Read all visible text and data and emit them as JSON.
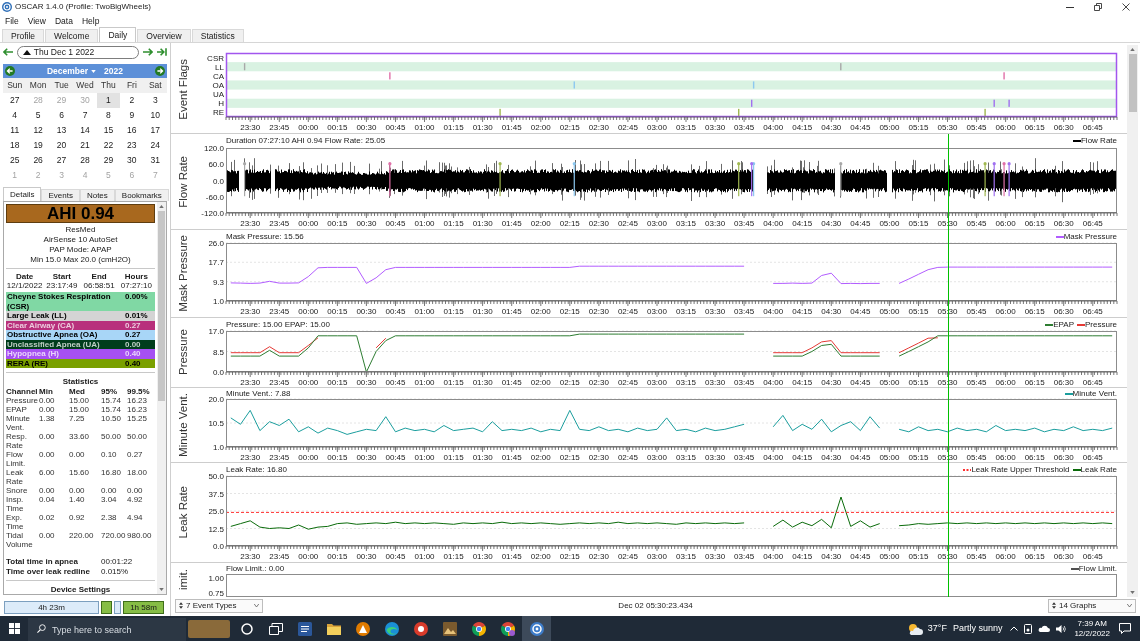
{
  "window": {
    "title": "OSCAR 1.4.0 (Profile: TwoBigWheels)"
  },
  "menu": [
    "File",
    "View",
    "Data",
    "Help"
  ],
  "tabs": [
    {
      "label": "Profile",
      "selected": false
    },
    {
      "label": "Welcome",
      "selected": false
    },
    {
      "label": "Daily",
      "selected": true
    },
    {
      "label": "Overview",
      "selected": false
    },
    {
      "label": "Statistics",
      "selected": false
    }
  ],
  "date_nav": {
    "value": "Thu Dec 1 2022"
  },
  "calendar": {
    "month": "December",
    "year": "2022",
    "weekdays": [
      "Sun",
      "Mon",
      "Tue",
      "Wed",
      "Thu",
      "Fri",
      "Sat"
    ],
    "weeks": [
      [
        {
          "day": "27",
          "muted": false,
          "selected": false
        },
        {
          "day": "28",
          "muted": true,
          "selected": false
        },
        {
          "day": "29",
          "muted": true,
          "selected": false
        },
        {
          "day": "30",
          "muted": true,
          "selected": false
        },
        {
          "day": "1",
          "muted": false,
          "selected": true
        },
        {
          "day": "2",
          "muted": false,
          "selected": false
        },
        {
          "day": "3",
          "muted": false,
          "selected": false
        }
      ],
      [
        {
          "day": "4",
          "muted": false,
          "selected": false
        },
        {
          "day": "5",
          "muted": false,
          "selected": false
        },
        {
          "day": "6",
          "muted": false,
          "selected": false
        },
        {
          "day": "7",
          "muted": false,
          "selected": false
        },
        {
          "day": "8",
          "muted": false,
          "selected": false
        },
        {
          "day": "9",
          "muted": false,
          "selected": false
        },
        {
          "day": "10",
          "muted": false,
          "selected": false
        }
      ],
      [
        {
          "day": "11",
          "muted": false,
          "selected": false
        },
        {
          "day": "12",
          "muted": false,
          "selected": false
        },
        {
          "day": "13",
          "muted": false,
          "selected": false
        },
        {
          "day": "14",
          "muted": false,
          "selected": false
        },
        {
          "day": "15",
          "muted": false,
          "selected": false
        },
        {
          "day": "16",
          "muted": false,
          "selected": false
        },
        {
          "day": "17",
          "muted": false,
          "selected": false
        }
      ],
      [
        {
          "day": "18",
          "muted": false,
          "selected": false
        },
        {
          "day": "19",
          "muted": false,
          "selected": false
        },
        {
          "day": "20",
          "muted": false,
          "selected": false
        },
        {
          "day": "21",
          "muted": false,
          "selected": false
        },
        {
          "day": "22",
          "muted": false,
          "selected": false
        },
        {
          "day": "23",
          "muted": false,
          "selected": false
        },
        {
          "day": "24",
          "muted": false,
          "selected": false
        }
      ],
      [
        {
          "day": "25",
          "muted": false,
          "selected": false
        },
        {
          "day": "26",
          "muted": false,
          "selected": false
        },
        {
          "day": "27",
          "muted": false,
          "selected": false
        },
        {
          "day": "28",
          "muted": false,
          "selected": false
        },
        {
          "day": "29",
          "muted": false,
          "selected": false
        },
        {
          "day": "30",
          "muted": false,
          "selected": false
        },
        {
          "day": "31",
          "muted": false,
          "selected": false
        }
      ],
      [
        {
          "day": "1",
          "muted": true,
          "selected": false
        },
        {
          "day": "2",
          "muted": true,
          "selected": false
        },
        {
          "day": "3",
          "muted": true,
          "selected": false
        },
        {
          "day": "4",
          "muted": true,
          "selected": false
        },
        {
          "day": "5",
          "muted": true,
          "selected": false
        },
        {
          "day": "6",
          "muted": true,
          "selected": false
        },
        {
          "day": "7",
          "muted": true,
          "selected": false
        }
      ]
    ]
  },
  "detail_tabs": [
    {
      "label": "Details",
      "selected": true
    },
    {
      "label": "Events",
      "selected": false
    },
    {
      "label": "Notes",
      "selected": false
    },
    {
      "label": "Bookmarks",
      "selected": false
    }
  ],
  "details": {
    "ahi": "AHI 0.94",
    "machine": [
      "ResMed",
      "AirSense 10 AutoSet",
      "PAP Mode: APAP",
      "Min 15.0 Max 20.0 (cmH2O)"
    ],
    "session_header": [
      "Date",
      "Start",
      "End",
      "Hours"
    ],
    "session_row": [
      "12/1/2022",
      "23:17:49",
      "06:58:51",
      "07:27:10"
    ],
    "events": [
      {
        "label": "Cheyne Stokes Respiration (CSR)",
        "value": "0.00%",
        "color": "#80d8a4"
      },
      {
        "label": "Large Leak (LL)",
        "value": "0.01%",
        "color": "#d4d4d4"
      },
      {
        "label": "Clear Airway (CA)",
        "value": "0.27",
        "color": "#b8307c"
      },
      {
        "label": "Obstructive Apnea (OA)",
        "value": "0.27",
        "color": "#a8d6f7"
      },
      {
        "label": "Unclassified Apnea (UA)",
        "value": "0.00",
        "color": "#003d1c"
      },
      {
        "label": "Hypopnea (H)",
        "value": "0.40",
        "color": "#a650f2"
      },
      {
        "label": "RERA (RE)",
        "value": "0.40",
        "color": "#7aa000"
      }
    ],
    "statistics_title": "Statistics",
    "statistics_header": [
      "Channel",
      "Min",
      "Med",
      "95%",
      "99.5%"
    ],
    "statistics_rows": [
      [
        "Pressure",
        "0.00",
        "15.00",
        "15.74",
        "16.23"
      ],
      [
        "EPAP",
        "0.00",
        "15.00",
        "15.74",
        "16.23"
      ],
      [
        "Minute Vent.",
        "1.38",
        "7.25",
        "10.50",
        "15.25"
      ],
      [
        "Resp. Rate",
        "0.00",
        "33.60",
        "50.00",
        "50.00"
      ],
      [
        "Flow Limit.",
        "0.00",
        "0.00",
        "0.10",
        "0.27"
      ],
      [
        "Leak Rate",
        "6.00",
        "15.60",
        "16.80",
        "18.00"
      ],
      [
        "Snore",
        "0.00",
        "0.00",
        "0.00",
        "0.00"
      ],
      [
        "Insp. Time",
        "0.04",
        "1.40",
        "3.04",
        "4.92"
      ],
      [
        "Exp. Time",
        "0.02",
        "0.92",
        "2.38",
        "4.94"
      ],
      [
        "Tidal Volume",
        "0.00",
        "220.00",
        "720.00",
        "980.00"
      ]
    ],
    "totals": [
      {
        "label": "Total time in apnea",
        "value": "00:01:22"
      },
      {
        "label": "Time over leak redline",
        "value": "0.015%"
      }
    ],
    "next_section": "Device Settings"
  },
  "session_bar": [
    {
      "label": "4h 23m",
      "selected": false
    },
    {
      "selected": true
    },
    {
      "selected": false
    },
    {
      "label": "1h 58m",
      "selected": true
    }
  ],
  "graphs": [
    {
      "kind": "flags",
      "title": "Event Flags",
      "row_labels": [
        "CSR",
        "LL",
        "CA",
        "OA",
        "UA",
        "H",
        "RE"
      ],
      "x_labels": [
        "23:30",
        "23:45",
        "00:00",
        "00:15",
        "00:30",
        "00:45",
        "01:00",
        "01:15",
        "01:30",
        "01:45",
        "02:00",
        "02:15",
        "02:30",
        "02:45",
        "03:00",
        "03:15",
        "03:30",
        "03:45",
        "04:00",
        "04:15",
        "04:30",
        "04:45",
        "05:00",
        "05:15",
        "05:30",
        "05:45",
        "06:00",
        "06:15",
        "06:30",
        "06:45"
      ]
    },
    {
      "kind": "waveform",
      "title": "Flow Rate",
      "header": "Duration 07:27:10 AHI 0.94 Flow Rate: 25.05",
      "legend": [
        "Flow Rate"
      ],
      "y_labels": [
        "120.0",
        "60.0",
        "0.0",
        "-60.0",
        "-120.0"
      ],
      "x_labels": [
        "23:30",
        "23:45",
        "00:00",
        "00:15",
        "00:30",
        "00:45",
        "01:00",
        "01:15",
        "01:30",
        "01:45",
        "02:00",
        "02:15",
        "02:30",
        "02:45",
        "03:00",
        "03:15",
        "03:30",
        "03:45",
        "04:00",
        "04:15",
        "04:30",
        "04:45",
        "05:00",
        "05:15",
        "05:30",
        "05:45",
        "06:00",
        "06:15",
        "06:30",
        "06:45"
      ]
    },
    {
      "kind": "chart",
      "title": "Mask Pressure",
      "header": "Mask Pressure: 15.56",
      "chart_data": {
        "type": "line",
        "categories": [
          null,
          null,
          "23:30",
          null,
          null,
          "23:45",
          null,
          null,
          "00:00",
          null,
          null,
          "00:15",
          null,
          null,
          "00:30",
          null,
          null,
          "00:45",
          null,
          null,
          "01:00",
          null,
          null,
          "01:15",
          null,
          null,
          "01:30",
          null,
          null,
          "01:45",
          null,
          null,
          "02:00",
          null,
          null,
          "02:15",
          null,
          null,
          "02:30",
          null,
          null,
          "02:45",
          null,
          null,
          "03:00",
          null,
          null,
          "03:15",
          null,
          null,
          "03:30",
          null,
          null,
          "03:45",
          null,
          null,
          "04:00",
          null,
          null,
          "04:15",
          null,
          null,
          "04:30",
          null,
          null,
          "04:45",
          null,
          null,
          "05:00",
          null,
          null,
          "05:15",
          null,
          null,
          "05:30",
          null,
          null,
          "05:45",
          null,
          null,
          "06:00",
          null,
          null,
          "06:15",
          null,
          null,
          "06:30",
          null,
          null,
          "06:45",
          null,
          null
        ],
        "ylim": [
          1,
          26
        ],
        "yticks": [
          {
            "value": 26,
            "label": "26.0"
          },
          {
            "value": 17.7,
            "label": "17.7"
          },
          {
            "value": 9.3,
            "label": "9.3"
          },
          {
            "value": 1,
            "label": "1.0"
          }
        ],
        "grid": true,
        "series": [
          {
            "name": "Mask Pressure",
            "color": "#b25cff",
            "values": [
              8.8,
              8.7,
              8.6,
              8.7,
              9.5,
              8.7,
              8.7,
              8.8,
              11.5,
              15.3,
              15.5,
              15.5,
              15.5,
              15.5,
              8.6,
              11.0,
              14.5,
              15.5,
              15.5,
              15.5,
              15.5,
              15.5,
              15.5,
              15.5,
              15.5,
              15.5,
              15.5,
              15.5,
              15.5,
              15.5,
              15.5,
              15.5,
              15.5,
              15.5,
              15.5,
              15.5,
              16.0,
              16.0,
              16.0,
              16.0,
              16.0,
              16.0,
              16.0,
              16.0,
              16.0,
              16.0,
              16.0,
              16.0,
              16.0,
              16.0,
              16.0,
              16.0,
              16.0,
              16.0,
              null,
              null,
              8.6,
              8.6,
              8.7,
              8.6,
              8.7,
              12.0,
              13.0,
              8.5,
              8.6,
              8.5,
              8.6,
              8.6,
              null,
              8.6,
              10.5,
              12.5,
              14.5,
              15.5,
              15.6,
              15.6,
              15.6,
              15.6,
              15.6,
              15.6,
              15.6,
              15.6,
              15.6,
              15.6,
              15.6,
              15.6,
              15.6,
              15.6,
              15.6,
              15.6,
              15.6,
              15.6
            ]
          }
        ]
      }
    },
    {
      "kind": "chart",
      "title": "Pressure",
      "header": "Pressure: 15.00 EPAP: 15.00",
      "chart_data": {
        "type": "line",
        "categories": [
          null,
          null,
          "23:30",
          null,
          null,
          "23:45",
          null,
          null,
          "00:00",
          null,
          null,
          "00:15",
          null,
          null,
          "00:30",
          null,
          null,
          "00:45",
          null,
          null,
          "01:00",
          null,
          null,
          "01:15",
          null,
          null,
          "01:30",
          null,
          null,
          "01:45",
          null,
          null,
          "02:00",
          null,
          null,
          "02:15",
          null,
          null,
          "02:30",
          null,
          null,
          "02:45",
          null,
          null,
          "03:00",
          null,
          null,
          "03:15",
          null,
          null,
          "03:30",
          null,
          null,
          "03:45",
          null,
          null,
          "04:00",
          null,
          null,
          "04:15",
          null,
          null,
          "04:30",
          null,
          null,
          "04:45",
          null,
          null,
          "05:00",
          null,
          null,
          "05:15",
          null,
          null,
          "05:30",
          null,
          null,
          "05:45",
          null,
          null,
          "06:00",
          null,
          null,
          "06:15",
          null,
          null,
          "06:30",
          null,
          null,
          "06:45",
          null,
          null
        ],
        "ylim": [
          0,
          17
        ],
        "yticks": [
          {
            "value": 17,
            "label": "17.0"
          },
          {
            "value": 8.5,
            "label": "8.5"
          },
          {
            "value": 0,
            "label": "0.0"
          }
        ],
        "grid": true,
        "series": [
          {
            "name": "EPAP",
            "color": "#2e7d32",
            "values": [
              6.6,
              6.6,
              6.6,
              6.6,
              9.0,
              6.6,
              6.6,
              6.6,
              10.0,
              15.0,
              15.0,
              15.0,
              15.0,
              15.0,
              0.0,
              8.5,
              13.0,
              15.0,
              15.0,
              15.0,
              15.0,
              15.0,
              15.0,
              15.0,
              15.0,
              15.0,
              15.0,
              15.0,
              15.0,
              15.0,
              15.0,
              15.0,
              15.0,
              15.0,
              15.0,
              15.0,
              15.7,
              15.7,
              15.7,
              15.7,
              15.7,
              15.7,
              15.7,
              15.7,
              15.7,
              15.7,
              15.7,
              15.7,
              15.7,
              15.7,
              15.7,
              15.7,
              15.7,
              15.7,
              null,
              null,
              6.6,
              6.6,
              6.6,
              6.6,
              8.5,
              11.0,
              11.5,
              6.6,
              6.6,
              6.6,
              6.6,
              6.6,
              null,
              6.6,
              8.5,
              10.5,
              12.5,
              15.0,
              15.0,
              15.0,
              15.0,
              15.0,
              15.0,
              15.0,
              15.0,
              15.0,
              15.0,
              15.0,
              15.0,
              15.0,
              15.0,
              15.0,
              15.0,
              15.0,
              15.0,
              15.0
            ]
          },
          {
            "name": "Pressure",
            "color": "#e53935",
            "values": [
              8.0,
              8.0,
              8.0,
              8.0,
              10.5,
              8.0,
              8.0,
              8.0,
              11.0,
              14.2,
              null,
              null,
              null,
              null,
              null,
              10.0,
              14.0,
              null,
              null,
              null,
              null,
              null,
              null,
              null,
              null,
              null,
              null,
              null,
              null,
              null,
              null,
              null,
              null,
              null,
              null,
              null,
              null,
              null,
              null,
              null,
              null,
              null,
              null,
              null,
              null,
              null,
              null,
              null,
              null,
              null,
              null,
              null,
              null,
              null,
              null,
              null,
              8.0,
              8.0,
              8.0,
              8.0,
              10.0,
              12.5,
              13.0,
              8.0,
              8.0,
              8.0,
              8.0,
              8.0,
              null,
              8.0,
              10.0,
              12.0,
              14.0,
              14.2,
              null,
              null,
              null,
              null,
              null,
              null,
              null,
              null,
              null,
              null,
              null,
              null,
              null,
              null,
              null,
              null,
              null,
              null
            ]
          }
        ]
      }
    },
    {
      "kind": "chart",
      "title": "Minute Vent.",
      "header": "Minute Vent.: 7.88",
      "chart_data": {
        "type": "line",
        "categories": [
          null,
          null,
          "23:30",
          null,
          null,
          "23:45",
          null,
          null,
          "00:00",
          null,
          null,
          "00:15",
          null,
          null,
          "00:30",
          null,
          null,
          "00:45",
          null,
          null,
          "01:00",
          null,
          null,
          "01:15",
          null,
          null,
          "01:30",
          null,
          null,
          "01:45",
          null,
          null,
          "02:00",
          null,
          null,
          "02:15",
          null,
          null,
          "02:30",
          null,
          null,
          "02:45",
          null,
          null,
          "03:00",
          null,
          null,
          "03:15",
          null,
          null,
          "03:30",
          null,
          null,
          "03:45",
          null,
          null,
          "04:00",
          null,
          null,
          "04:15",
          null,
          null,
          "04:30",
          null,
          null,
          "04:45",
          null,
          null,
          "05:00",
          null,
          null,
          "05:15",
          null,
          null,
          "05:30",
          null,
          null,
          "05:45",
          null,
          null,
          "06:00",
          null,
          null,
          "06:15",
          null,
          null,
          "06:30",
          null,
          null,
          "06:45",
          null,
          null
        ],
        "ylim": [
          1,
          20
        ],
        "yticks": [
          {
            "value": 20,
            "label": "20.0"
          },
          {
            "value": 10.5,
            "label": "10.5"
          },
          {
            "value": 1,
            "label": "1.0"
          }
        ],
        "grid": true,
        "series": [
          {
            "name": "Minute Vent.",
            "color": "#1b9e9e",
            "values": [
              12.5,
              10.0,
              15.5,
              7.5,
              11.0,
              9.5,
              12.0,
              7.0,
              9.0,
              6.5,
              8.5,
              7.5,
              6.0,
              7.0,
              8.0,
              7.5,
              13.0,
              7.0,
              8.5,
              7.5,
              8.0,
              7.0,
              9.5,
              7.5,
              8.0,
              8.5,
              7.0,
              11.0,
              7.5,
              8.0,
              7.5,
              8.5,
              7.0,
              8.0,
              7.5,
              15.5,
              8.0,
              7.5,
              9.0,
              7.5,
              8.0,
              7.0,
              8.5,
              7.5,
              8.0,
              12.5,
              7.5,
              8.0,
              7.0,
              8.5,
              7.5,
              8.0,
              9.0,
              10.0,
              null,
              null,
              9.0,
              13.5,
              7.5,
              10.0,
              8.0,
              12.0,
              7.0,
              9.5,
              11.0,
              7.5,
              13.0,
              8.5,
              null,
              8.0,
              7.0,
              9.0,
              7.5,
              8.0,
              7.0,
              8.5,
              7.5,
              8.0,
              7.0,
              9.5,
              7.5,
              8.0,
              7.5,
              8.5,
              7.0,
              8.0,
              7.5,
              9.0,
              7.5,
              8.0,
              7.5,
              8.5
            ]
          }
        ]
      }
    },
    {
      "kind": "chart",
      "title": "Leak Rate",
      "header": "Leak Rate: 16.80",
      "chart_data": {
        "type": "line",
        "categories": [
          null,
          null,
          "23:30",
          null,
          null,
          "23:45",
          null,
          null,
          "00:00",
          null,
          null,
          "00:15",
          null,
          null,
          "00:30",
          null,
          null,
          "00:45",
          null,
          null,
          "01:00",
          null,
          null,
          "01:15",
          null,
          null,
          "01:30",
          null,
          null,
          "01:45",
          null,
          null,
          "02:00",
          null,
          null,
          "02:15",
          null,
          null,
          "02:30",
          null,
          null,
          "02:45",
          null,
          null,
          "03:00",
          null,
          null,
          "03:15",
          null,
          null,
          "03:30",
          null,
          null,
          "03:45",
          null,
          null,
          "04:00",
          null,
          null,
          "04:15",
          null,
          null,
          "04:30",
          null,
          null,
          "04:45",
          null,
          null,
          "05:00",
          null,
          null,
          "05:15",
          null,
          null,
          "05:30",
          null,
          null,
          "05:45",
          null,
          null,
          "06:00",
          null,
          null,
          "06:15",
          null,
          null,
          "06:30",
          null,
          null,
          "06:45",
          null,
          null
        ],
        "ylim": [
          0,
          50
        ],
        "yticks": [
          {
            "value": 50,
            "label": "50.0"
          },
          {
            "value": 37.5,
            "label": "37.5"
          },
          {
            "value": 25,
            "label": "25.0"
          },
          {
            "value": 12.5,
            "label": "12.5"
          },
          {
            "value": 0,
            "label": "0.0"
          }
        ],
        "grid": true,
        "ref_lines": [
          {
            "axis": "y",
            "value": 24,
            "label": "Leak Rate Upper Threshold",
            "color": "#ff3030"
          }
        ],
        "series": [
          {
            "name": "Leak Rate",
            "color": "#0a6b0a",
            "values": [
              14.0,
              16.0,
              18.0,
              13.5,
              12.5,
              13.0,
              12.5,
              15.0,
              12.0,
              13.5,
              14.0,
              16.0,
              16.5,
              15.5,
              16.0,
              16.5,
              16.0,
              17.0,
              16.0,
              16.5,
              16.0,
              16.5,
              16.0,
              15.5,
              16.5,
              16.0,
              16.5,
              16.0,
              17.0,
              16.0,
              16.5,
              16.0,
              16.5,
              16.0,
              15.5,
              16.0,
              16.5,
              16.0,
              16.5,
              16.0,
              17.0,
              16.0,
              16.5,
              16.0,
              16.5,
              16.0,
              15.5,
              16.5,
              16.0,
              16.5,
              16.0,
              16.5,
              16.0,
              16.5,
              null,
              null,
              14.0,
              18.5,
              13.5,
              17.0,
              14.5,
              19.0,
              13.0,
              35.0,
              14.0,
              18.0,
              13.5,
              16.0,
              null,
              14.5,
              15.0,
              16.0,
              15.5,
              16.0,
              16.5,
              16.0,
              16.5,
              16.0,
              16.5,
              16.0,
              16.5,
              16.0,
              16.5,
              16.0,
              16.5,
              16.0,
              16.5,
              16.0,
              16.5,
              16.0,
              16.5,
              16.0
            ]
          }
        ]
      }
    },
    {
      "kind": "cut",
      "title": "imit.",
      "header": "Flow Limit.: 0.00",
      "legend": [
        "Flow Limit."
      ],
      "y_labels": [
        "1.00",
        "0.75"
      ]
    }
  ],
  "graph_cursor": {
    "level": 0.811
  },
  "status_bar": {
    "event_types": "7 Event Types",
    "timestamp": "Dec 02 05:30:23.434",
    "graph_count": "14 Graphs"
  },
  "taskbar": {
    "search_placeholder": "Type here to search",
    "apps": [
      {
        "selected": false
      },
      {
        "selected": false
      },
      {
        "selected": false
      },
      {
        "selected": false
      },
      {
        "selected": false
      },
      {
        "selected": false
      },
      {
        "selected": false
      },
      {
        "selected": false
      },
      {
        "selected": false
      },
      {
        "selected": false
      },
      {
        "selected": true
      }
    ],
    "temperature": "37°F",
    "weather": "Partly sunny",
    "time": "7:39 AM",
    "date": "12/2/2022"
  }
}
